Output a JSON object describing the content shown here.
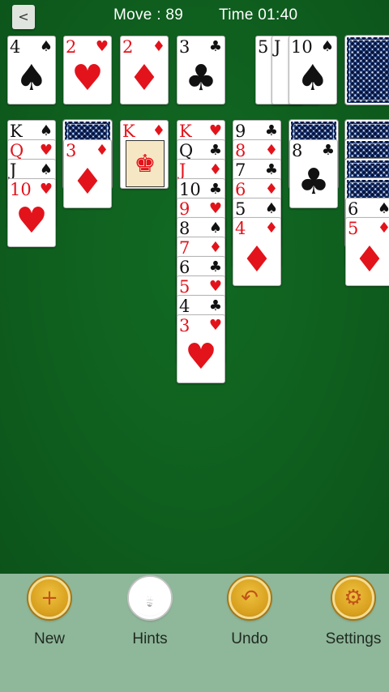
{
  "header": {
    "back_label": "<",
    "move_text": "Move : 89",
    "time_text": "Time 01:40"
  },
  "foundations": [
    {
      "rank": "4",
      "suit": "♠",
      "color": "black"
    },
    {
      "rank": "2",
      "suit": "♥",
      "color": "red"
    },
    {
      "rank": "2",
      "suit": "♦",
      "color": "red"
    },
    {
      "rank": "3",
      "suit": "♣",
      "color": "black"
    }
  ],
  "waste": [
    {
      "rank": "5",
      "suit": "♣",
      "color": "black"
    },
    {
      "rank": "J",
      "suit": "♣",
      "color": "black"
    },
    {
      "rank": "10",
      "suit": "♠",
      "color": "black"
    }
  ],
  "tableau": [
    {
      "hidden": 0,
      "cards": [
        {
          "rank": "K",
          "suit": "♠",
          "color": "black"
        },
        {
          "rank": "Q",
          "suit": "♥",
          "color": "red"
        },
        {
          "rank": "J",
          "suit": "♠",
          "color": "black"
        },
        {
          "rank": "10",
          "suit": "♥",
          "color": "red"
        }
      ]
    },
    {
      "hidden": 1,
      "cards": [
        {
          "rank": "3",
          "suit": "♦",
          "color": "red"
        }
      ]
    },
    {
      "hidden": 0,
      "cards": [
        {
          "rank": "K",
          "suit": "♦",
          "color": "red",
          "face": true
        }
      ]
    },
    {
      "hidden": 0,
      "cards": [
        {
          "rank": "K",
          "suit": "♥",
          "color": "red"
        },
        {
          "rank": "Q",
          "suit": "♣",
          "color": "black"
        },
        {
          "rank": "J",
          "suit": "♦",
          "color": "red"
        },
        {
          "rank": "10",
          "suit": "♣",
          "color": "black"
        },
        {
          "rank": "9",
          "suit": "♥",
          "color": "red"
        },
        {
          "rank": "8",
          "suit": "♠",
          "color": "black"
        },
        {
          "rank": "7",
          "suit": "♦",
          "color": "red"
        },
        {
          "rank": "6",
          "suit": "♣",
          "color": "black"
        },
        {
          "rank": "5",
          "suit": "♥",
          "color": "red"
        },
        {
          "rank": "4",
          "suit": "♣",
          "color": "black"
        },
        {
          "rank": "3",
          "suit": "♥",
          "color": "red"
        }
      ]
    },
    {
      "hidden": 0,
      "cards": [
        {
          "rank": "9",
          "suit": "♣",
          "color": "black"
        },
        {
          "rank": "8",
          "suit": "♦",
          "color": "red"
        },
        {
          "rank": "7",
          "suit": "♣",
          "color": "black"
        },
        {
          "rank": "6",
          "suit": "♦",
          "color": "red"
        },
        {
          "rank": "5",
          "suit": "♠",
          "color": "black"
        },
        {
          "rank": "4",
          "suit": "♦",
          "color": "red"
        }
      ]
    },
    {
      "hidden": 1,
      "cards": [
        {
          "rank": "8",
          "suit": "♣",
          "color": "black"
        }
      ]
    },
    {
      "hidden": 4,
      "cards": [
        {
          "rank": "6",
          "suit": "♠",
          "color": "black"
        },
        {
          "rank": "5",
          "suit": "♦",
          "color": "red"
        }
      ]
    }
  ],
  "toolbar": [
    {
      "label": "New",
      "icon": "plus-icon",
      "glyph": "+"
    },
    {
      "label": "Hints",
      "icon": "lightbulb-icon",
      "glyph": "💡"
    },
    {
      "label": "Undo",
      "icon": "undo-icon",
      "glyph": "↶"
    },
    {
      "label": "Settings",
      "icon": "gear-icon",
      "glyph": "⚙"
    }
  ],
  "colors": {
    "felt": "#0f5f1f",
    "toolbar": "#8fb79a",
    "red_suit": "#e3131b",
    "black_suit": "#111111"
  }
}
